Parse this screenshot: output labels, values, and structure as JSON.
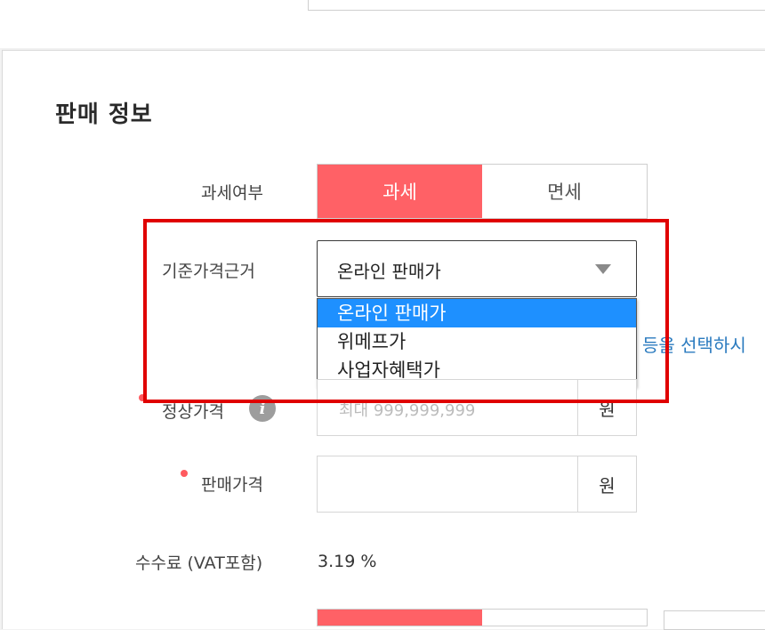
{
  "section": {
    "title": "판매 정보"
  },
  "tax": {
    "label": "과세여부",
    "options": [
      "과세",
      "면세"
    ],
    "selected": "과세"
  },
  "base_price": {
    "label": "기준가격근거",
    "selected_value": "온라인 판매가",
    "options": [
      "온라인 판매가",
      "위메프가",
      "사업자혜택가"
    ],
    "hint": "등을 선택하시"
  },
  "regular_price": {
    "label": "정상가격",
    "placeholder": "최대 999,999,999",
    "unit": "원"
  },
  "sale_price": {
    "label": "판매가격",
    "value": "",
    "unit": "원"
  },
  "fee": {
    "label": "수수료 (VAT포함)",
    "value": "3.19 %"
  },
  "colors": {
    "accent": "#ff6166",
    "highlight_box": "#e00000",
    "selected_option": "#1e90ff",
    "hint": "#2b7bbf"
  },
  "icons": {
    "info": "info-icon",
    "dropdown_arrow": "triangle-down-icon"
  }
}
